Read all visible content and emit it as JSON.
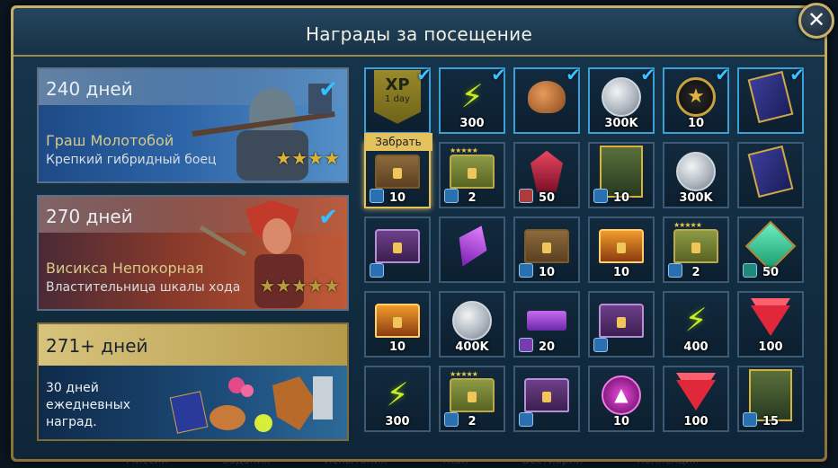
{
  "window": {
    "title": "Награды за посещение",
    "close_label": "✕"
  },
  "background_tabs": [
    "Миссии",
    "Задания",
    "Испытания",
    "Titan",
    "Бестиарий",
    "Коллекция"
  ],
  "heroes": [
    {
      "days": "240 дней",
      "name": "Граш Молотобой",
      "desc": "Крепкий гибридный боец",
      "stars": "★★★★",
      "claimed": true
    },
    {
      "days": "270 дней",
      "name": "Висикса Непокорная",
      "desc": "Властительница шкалы хода",
      "stars": "★★★★★",
      "claimed": true
    },
    {
      "days": "271+ дней",
      "desc": "30 дней ежедневных наград."
    }
  ],
  "claim_label": "Забрать",
  "xp_item": {
    "big": "XP",
    "small": "1 day"
  },
  "rewards": [
    {
      "icon": "xp-boost-icon",
      "qty": "",
      "claimed": true
    },
    {
      "icon": "energy-bolt-icon",
      "qty": "300",
      "claimed": true
    },
    {
      "icon": "roasted-chicken-icon",
      "qty": "",
      "claimed": true
    },
    {
      "icon": "silver-coin-icon",
      "qty": "300K",
      "claimed": true
    },
    {
      "icon": "arena-token-icon",
      "qty": "10",
      "claimed": true
    },
    {
      "icon": "skill-tome-icon",
      "qty": "",
      "claimed": true
    },
    {
      "icon": "brown-chest-icon",
      "qty": "10",
      "today": true
    },
    {
      "icon": "green-chest-icon",
      "qty": "2"
    },
    {
      "icon": "red-shard-icon",
      "qty": "50"
    },
    {
      "icon": "champion-portrait-icon",
      "qty": "10"
    },
    {
      "icon": "silver-coin-icon",
      "qty": "300K"
    },
    {
      "icon": "blue-tome-icon",
      "qty": ""
    },
    {
      "icon": "purple-chest-icon",
      "qty": ""
    },
    {
      "icon": "void-shard-icon",
      "qty": ""
    },
    {
      "icon": "brown-chest-icon",
      "qty": "10"
    },
    {
      "icon": "orange-chest-icon",
      "qty": "10"
    },
    {
      "icon": "green-chest-icon",
      "qty": "2"
    },
    {
      "icon": "green-gem-icon",
      "qty": "50"
    },
    {
      "icon": "orange-chest-icon",
      "qty": "10"
    },
    {
      "icon": "silver-coin-icon",
      "qty": "400K"
    },
    {
      "icon": "purple-hammer-icon",
      "qty": "20"
    },
    {
      "icon": "purple-chest-icon",
      "qty": ""
    },
    {
      "icon": "energy-bolt-icon",
      "qty": "400"
    },
    {
      "icon": "red-gem-icon",
      "qty": "100"
    },
    {
      "icon": "energy-bolt-icon",
      "qty": "300"
    },
    {
      "icon": "green-chest-icon",
      "qty": "2"
    },
    {
      "icon": "purple-chest-icon",
      "qty": ""
    },
    {
      "icon": "magenta-arrow-icon",
      "qty": "10"
    },
    {
      "icon": "red-gem-icon",
      "qty": "100"
    },
    {
      "icon": "champion-portrait-icon",
      "qty": "15"
    }
  ]
}
